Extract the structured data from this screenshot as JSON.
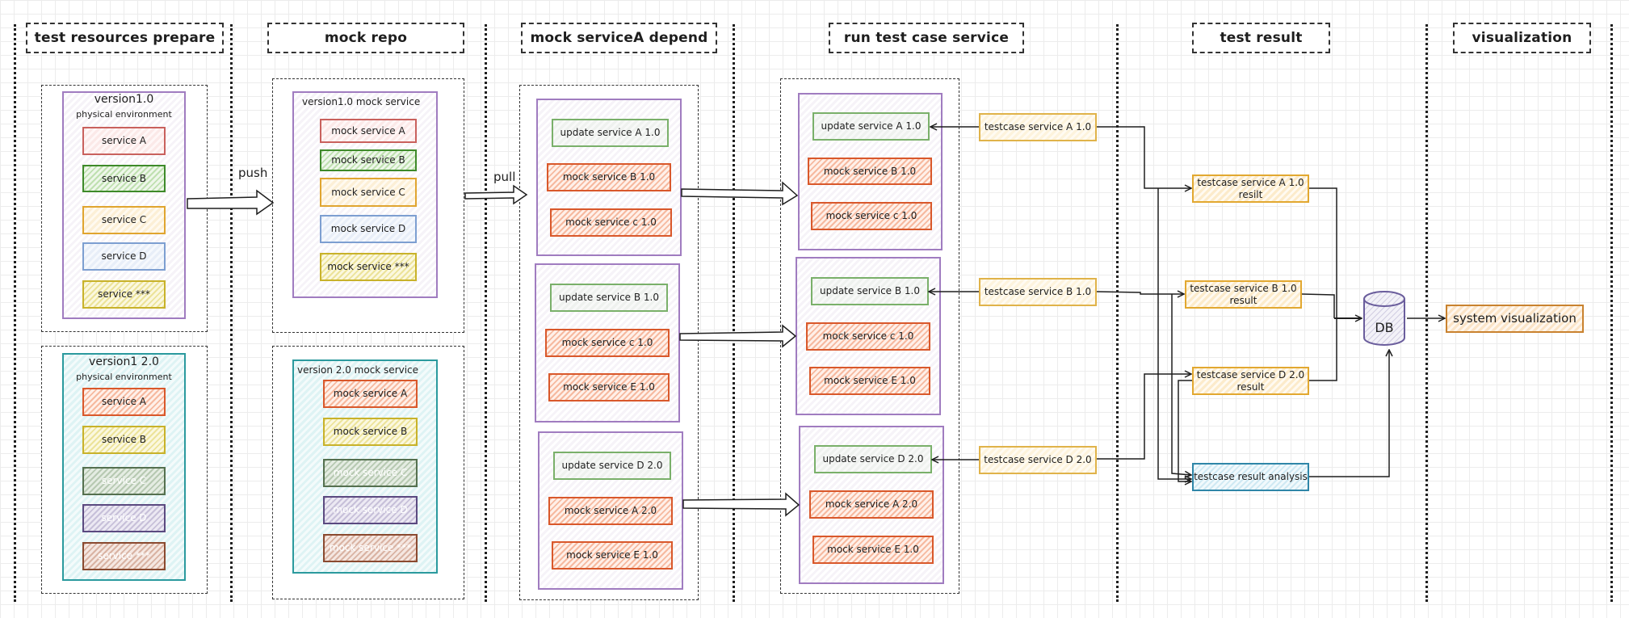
{
  "columns": [
    {
      "id": "prepare",
      "header": "test resources prepare"
    },
    {
      "id": "repo",
      "header": "mock repo"
    },
    {
      "id": "depend",
      "header": "mock serviceA depend"
    },
    {
      "id": "run",
      "header": "run test case service"
    },
    {
      "id": "result",
      "header": "test result"
    },
    {
      "id": "viz",
      "header": "visualization"
    }
  ],
  "prepare": {
    "v1": {
      "title": "version1.0",
      "subtitle": "physical environment",
      "services": [
        "service A",
        "service B",
        "service C",
        "service D",
        "service ***"
      ]
    },
    "v2": {
      "title": "version1 2.0",
      "subtitle": "physical environment",
      "services": [
        "service A",
        "service B",
        "service C",
        "service D",
        "service ***"
      ]
    }
  },
  "repo": {
    "v1": {
      "title": "version1.0 mock service",
      "services": [
        "mock service A",
        "mock service B",
        "mock service C",
        "mock service D",
        "mock service ***"
      ]
    },
    "v2": {
      "title": "version 2.0 mock service",
      "services": [
        "mock service A",
        "mock service B",
        "mock service C",
        "mock service D",
        "mock service ***"
      ]
    }
  },
  "arrows": {
    "push": "push",
    "pull": "pull"
  },
  "depend": {
    "groups": [
      {
        "update": "update service A 1.0",
        "mocks": [
          "mock service B 1.0",
          "mock service c 1.0"
        ]
      },
      {
        "update": "update service B 1.0",
        "mocks": [
          "mock service c 1.0",
          "mock service E 1.0"
        ]
      },
      {
        "update": "update service D 2.0",
        "mocks": [
          "mock service A 2.0",
          "mock service E 1.0"
        ]
      }
    ]
  },
  "run": {
    "groups": [
      {
        "update": "update service A 1.0",
        "mocks": [
          "mock service B 1.0",
          "mock service c 1.0"
        ]
      },
      {
        "update": "update service B 1.0",
        "mocks": [
          "mock service c 1.0",
          "mock service E 1.0"
        ]
      },
      {
        "update": "update service D 2.0",
        "mocks": [
          "mock service A 2.0",
          "mock service E 1.0"
        ]
      }
    ],
    "testcases": [
      "testcase service A 1.0",
      "testcase service B 1.0",
      "testcase service D 2.0"
    ]
  },
  "result": {
    "items": [
      {
        "line1": "testcase service A 1.0",
        "line2": "resilt"
      },
      {
        "line1": "testcase service B 1.0",
        "line2": "result"
      },
      {
        "line1": "testcase service D 2.0",
        "line2": "result"
      }
    ],
    "analysis": "testcase result analysis",
    "db": "DB"
  },
  "viz": {
    "system": "system visualization"
  },
  "colors": {
    "stroke": "#1e1e1e",
    "group_purple": "#a07cc0",
    "group_teal": "#2b9a9e",
    "update_green": "#7ab06a",
    "mock_coral": "#d9582b",
    "testcase_yellow": "#e0b34a",
    "analysis_blue": "#2f86a8",
    "db_purple": "#6a5d9c"
  }
}
